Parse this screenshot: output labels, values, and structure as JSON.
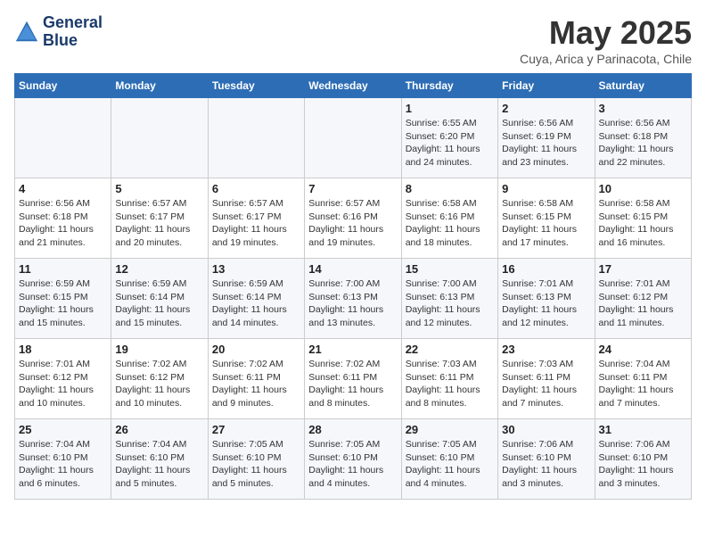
{
  "header": {
    "logo_line1": "General",
    "logo_line2": "Blue",
    "month": "May 2025",
    "location": "Cuya, Arica y Parinacota, Chile"
  },
  "weekdays": [
    "Sunday",
    "Monday",
    "Tuesday",
    "Wednesday",
    "Thursday",
    "Friday",
    "Saturday"
  ],
  "weeks": [
    [
      {
        "day": "",
        "info": ""
      },
      {
        "day": "",
        "info": ""
      },
      {
        "day": "",
        "info": ""
      },
      {
        "day": "",
        "info": ""
      },
      {
        "day": "1",
        "info": "Sunrise: 6:55 AM\nSunset: 6:20 PM\nDaylight: 11 hours\nand 24 minutes."
      },
      {
        "day": "2",
        "info": "Sunrise: 6:56 AM\nSunset: 6:19 PM\nDaylight: 11 hours\nand 23 minutes."
      },
      {
        "day": "3",
        "info": "Sunrise: 6:56 AM\nSunset: 6:18 PM\nDaylight: 11 hours\nand 22 minutes."
      }
    ],
    [
      {
        "day": "4",
        "info": "Sunrise: 6:56 AM\nSunset: 6:18 PM\nDaylight: 11 hours\nand 21 minutes."
      },
      {
        "day": "5",
        "info": "Sunrise: 6:57 AM\nSunset: 6:17 PM\nDaylight: 11 hours\nand 20 minutes."
      },
      {
        "day": "6",
        "info": "Sunrise: 6:57 AM\nSunset: 6:17 PM\nDaylight: 11 hours\nand 19 minutes."
      },
      {
        "day": "7",
        "info": "Sunrise: 6:57 AM\nSunset: 6:16 PM\nDaylight: 11 hours\nand 19 minutes."
      },
      {
        "day": "8",
        "info": "Sunrise: 6:58 AM\nSunset: 6:16 PM\nDaylight: 11 hours\nand 18 minutes."
      },
      {
        "day": "9",
        "info": "Sunrise: 6:58 AM\nSunset: 6:15 PM\nDaylight: 11 hours\nand 17 minutes."
      },
      {
        "day": "10",
        "info": "Sunrise: 6:58 AM\nSunset: 6:15 PM\nDaylight: 11 hours\nand 16 minutes."
      }
    ],
    [
      {
        "day": "11",
        "info": "Sunrise: 6:59 AM\nSunset: 6:15 PM\nDaylight: 11 hours\nand 15 minutes."
      },
      {
        "day": "12",
        "info": "Sunrise: 6:59 AM\nSunset: 6:14 PM\nDaylight: 11 hours\nand 15 minutes."
      },
      {
        "day": "13",
        "info": "Sunrise: 6:59 AM\nSunset: 6:14 PM\nDaylight: 11 hours\nand 14 minutes."
      },
      {
        "day": "14",
        "info": "Sunrise: 7:00 AM\nSunset: 6:13 PM\nDaylight: 11 hours\nand 13 minutes."
      },
      {
        "day": "15",
        "info": "Sunrise: 7:00 AM\nSunset: 6:13 PM\nDaylight: 11 hours\nand 12 minutes."
      },
      {
        "day": "16",
        "info": "Sunrise: 7:01 AM\nSunset: 6:13 PM\nDaylight: 11 hours\nand 12 minutes."
      },
      {
        "day": "17",
        "info": "Sunrise: 7:01 AM\nSunset: 6:12 PM\nDaylight: 11 hours\nand 11 minutes."
      }
    ],
    [
      {
        "day": "18",
        "info": "Sunrise: 7:01 AM\nSunset: 6:12 PM\nDaylight: 11 hours\nand 10 minutes."
      },
      {
        "day": "19",
        "info": "Sunrise: 7:02 AM\nSunset: 6:12 PM\nDaylight: 11 hours\nand 10 minutes."
      },
      {
        "day": "20",
        "info": "Sunrise: 7:02 AM\nSunset: 6:11 PM\nDaylight: 11 hours\nand 9 minutes."
      },
      {
        "day": "21",
        "info": "Sunrise: 7:02 AM\nSunset: 6:11 PM\nDaylight: 11 hours\nand 8 minutes."
      },
      {
        "day": "22",
        "info": "Sunrise: 7:03 AM\nSunset: 6:11 PM\nDaylight: 11 hours\nand 8 minutes."
      },
      {
        "day": "23",
        "info": "Sunrise: 7:03 AM\nSunset: 6:11 PM\nDaylight: 11 hours\nand 7 minutes."
      },
      {
        "day": "24",
        "info": "Sunrise: 7:04 AM\nSunset: 6:11 PM\nDaylight: 11 hours\nand 7 minutes."
      }
    ],
    [
      {
        "day": "25",
        "info": "Sunrise: 7:04 AM\nSunset: 6:10 PM\nDaylight: 11 hours\nand 6 minutes."
      },
      {
        "day": "26",
        "info": "Sunrise: 7:04 AM\nSunset: 6:10 PM\nDaylight: 11 hours\nand 5 minutes."
      },
      {
        "day": "27",
        "info": "Sunrise: 7:05 AM\nSunset: 6:10 PM\nDaylight: 11 hours\nand 5 minutes."
      },
      {
        "day": "28",
        "info": "Sunrise: 7:05 AM\nSunset: 6:10 PM\nDaylight: 11 hours\nand 4 minutes."
      },
      {
        "day": "29",
        "info": "Sunrise: 7:05 AM\nSunset: 6:10 PM\nDaylight: 11 hours\nand 4 minutes."
      },
      {
        "day": "30",
        "info": "Sunrise: 7:06 AM\nSunset: 6:10 PM\nDaylight: 11 hours\nand 3 minutes."
      },
      {
        "day": "31",
        "info": "Sunrise: 7:06 AM\nSunset: 6:10 PM\nDaylight: 11 hours\nand 3 minutes."
      }
    ]
  ]
}
